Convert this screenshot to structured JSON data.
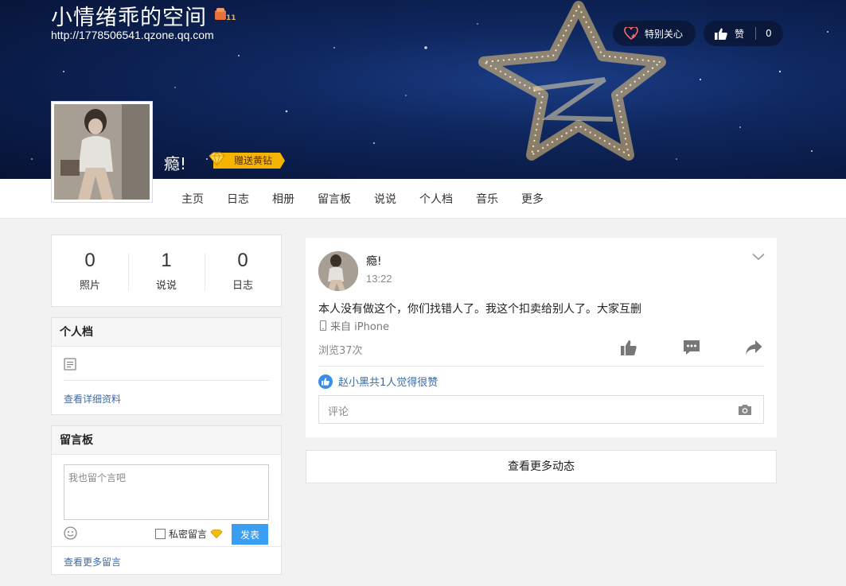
{
  "header": {
    "title": "小情绪乖的空间",
    "url": "http://1778506541.qzone.qq.com",
    "level_badge": "11",
    "follow_label": "特别关心",
    "like_label": "赞",
    "like_count": "0",
    "nickname": "瘾!",
    "gift_label": "赠送黄钻"
  },
  "nav": {
    "items": [
      "主页",
      "日志",
      "相册",
      "留言板",
      "说说",
      "个人档",
      "音乐",
      "更多"
    ]
  },
  "stats": [
    {
      "num": "0",
      "label": "照片"
    },
    {
      "num": "1",
      "label": "说说"
    },
    {
      "num": "0",
      "label": "日志"
    }
  ],
  "profile": {
    "title": "个人档",
    "link": "查看详细资料"
  },
  "board": {
    "title": "留言板",
    "placeholder": "我也留个言吧",
    "secret_label": "私密留言",
    "send_label": "发表",
    "more_link": "查看更多留言"
  },
  "feed": {
    "name": "瘾!",
    "time": "13:22",
    "text": "本人没有做这个，你们找错人了。我这个扣卖给别人了。大家互删",
    "source": "来自 iPhone",
    "views": "浏览37次",
    "liked_text": "赵小黑共1人觉得很赞",
    "comment_placeholder": "评论",
    "icons": [
      "thumbs-up-icon",
      "comment-icon",
      "share-icon",
      "chevron-down-icon",
      "camera-icon",
      "phone-icon"
    ]
  },
  "more_label": "查看更多动态",
  "colors": {
    "accent": "#3a9ef2",
    "link": "#3f6ba3",
    "banner": "#0f2860"
  }
}
